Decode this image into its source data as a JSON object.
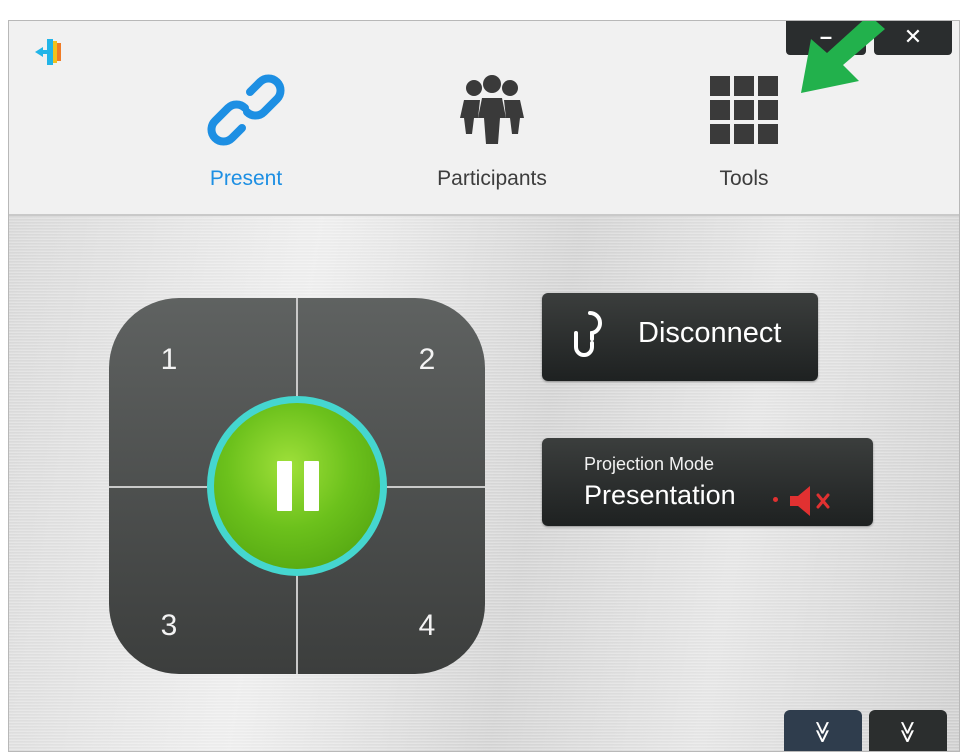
{
  "header": {
    "logo_icon": "app-logo-icon",
    "window_controls": {
      "minimize_icon": "minimize-icon",
      "close_label": "✕"
    },
    "annotation": {
      "icon": "green-arrow-icon",
      "color": "#22b14c"
    },
    "tabs": [
      {
        "label": "Present",
        "icon": "link-icon",
        "active": true,
        "active_color": "#1d8fe3"
      },
      {
        "label": "Participants",
        "icon": "participants-icon",
        "active": false
      },
      {
        "label": "Tools",
        "icon": "grid-icon",
        "active": false
      }
    ]
  },
  "quad_pad": {
    "quadrants": [
      "1",
      "2",
      "3",
      "4"
    ],
    "center_button": {
      "icon": "pause-icon",
      "state": "playing",
      "color": "#6cc11c",
      "ring_color": "#45d6cf"
    }
  },
  "disconnect_button": {
    "label": "Disconnect",
    "icon": "broken-link-icon"
  },
  "projection_mode": {
    "caption": "Projection Mode",
    "value": "Presentation",
    "audio_icon": "muted-speaker-icon",
    "audio_color": "#e13131"
  },
  "footer": {
    "buttons": [
      {
        "icon": "chevron-double-down-icon",
        "glyph": "≫"
      },
      {
        "icon": "chevron-double-down-icon",
        "glyph": "≫"
      }
    ]
  }
}
